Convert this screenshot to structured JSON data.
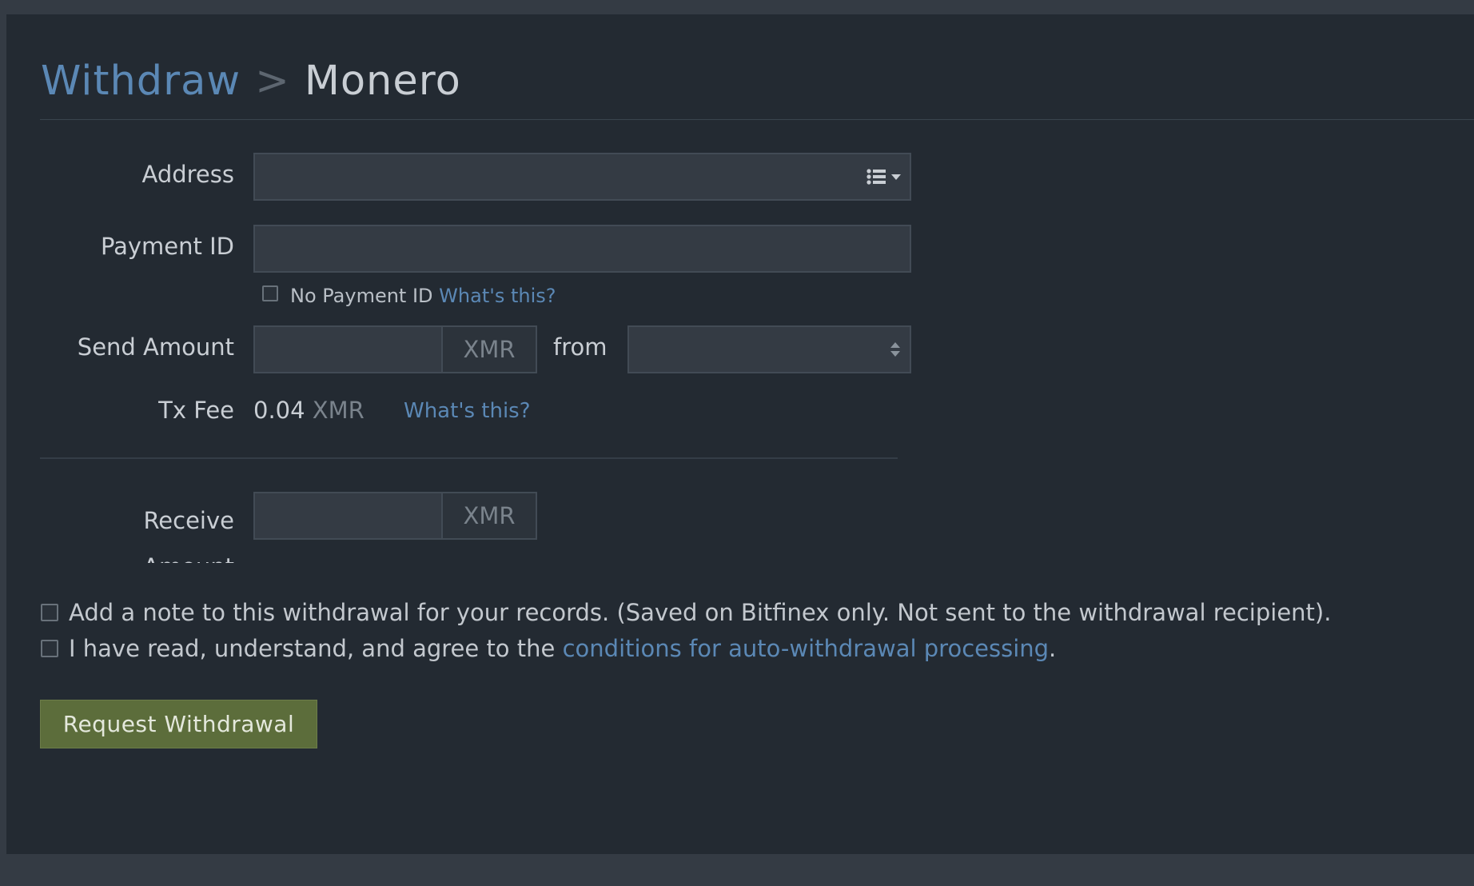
{
  "breadcrumb": {
    "parent": "Withdraw",
    "separator": ">",
    "current": "Monero"
  },
  "form": {
    "address": {
      "label": "Address",
      "value": "",
      "icon": "address-book-list-icon"
    },
    "payment_id": {
      "label": "Payment ID",
      "value": "",
      "no_payment_id_label": "No Payment ID",
      "whats_this": "What's this?"
    },
    "send_amount": {
      "label": "Send Amount",
      "value": "",
      "currency": "XMR",
      "from_label": "from",
      "wallet_selected": ""
    },
    "tx_fee": {
      "label": "Tx Fee",
      "amount": "0.04",
      "currency": "XMR",
      "whats_this": "What's this?"
    },
    "receive_amount": {
      "label_line1": "Receive",
      "label_line2": "Amount",
      "value": "",
      "currency": "XMR"
    }
  },
  "options": {
    "note_text": "Add a note to this withdrawal for your records. (Saved on Bitfinex only. Not sent to the withdrawal recipient).",
    "agree_prefix": "I have read, understand, and agree to the",
    "agree_link": "conditions for auto-withdrawal processing",
    "agree_suffix": "."
  },
  "actions": {
    "request_withdrawal": "Request Withdrawal"
  },
  "colors": {
    "page_bg": "#343b44",
    "panel_bg": "#232a32",
    "link": "#5b88b5",
    "button_bg": "#5c6d3b"
  }
}
